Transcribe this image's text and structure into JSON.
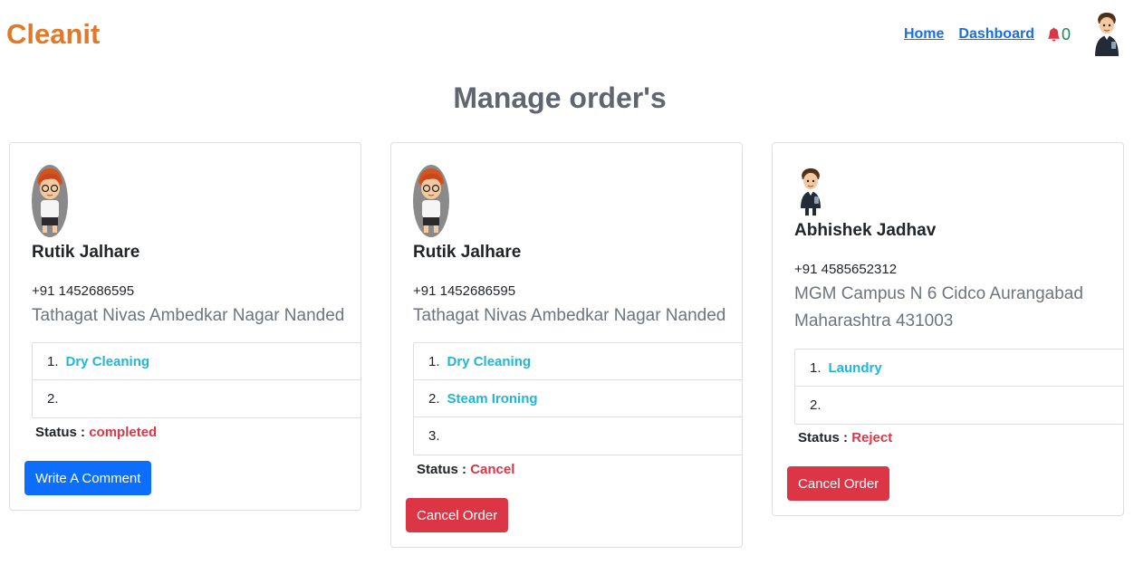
{
  "brand": "Cleanit",
  "nav": {
    "home": "Home",
    "dashboard": "Dashboard",
    "notification_count": "0"
  },
  "page_title": "Manage order's",
  "orders": [
    {
      "name": "Rutik Jalhare",
      "phone": "+91 1452686595",
      "address": "Tathagat Nivas Ambedkar Nagar Nanded",
      "services": [
        {
          "num": "1.",
          "name": "Dry Cleaning"
        },
        {
          "num": "2.",
          "name": ""
        }
      ],
      "status_label": "Status :",
      "status": "completed",
      "action": "Write A Comment"
    },
    {
      "name": "Rutik Jalhare",
      "phone": "+91 1452686595",
      "address": "Tathagat Nivas Ambedkar Nagar Nanded",
      "services": [
        {
          "num": "1.",
          "name": "Dry Cleaning"
        },
        {
          "num": "2.",
          "name": "Steam Ironing"
        },
        {
          "num": "3.",
          "name": ""
        }
      ],
      "status_label": "Status :",
      "status": "Cancel",
      "action": "Cancel Order"
    },
    {
      "name": "Abhishek Jadhav",
      "phone": "+91 4585652312",
      "address": "MGM Campus N 6 Cidco Aurangabad Maharashtra 431003",
      "services": [
        {
          "num": "1.",
          "name": "Laundry"
        },
        {
          "num": "2.",
          "name": ""
        }
      ],
      "status_label": "Status :",
      "status": "Reject",
      "action": "Cancel Order"
    }
  ],
  "colors": {
    "brand": "#e07a2a",
    "link": "#1a6fe0",
    "service": "#1fb6d8",
    "status": "#dc3545",
    "primary_button": "#0d6efd",
    "danger_button": "#dc3545"
  }
}
